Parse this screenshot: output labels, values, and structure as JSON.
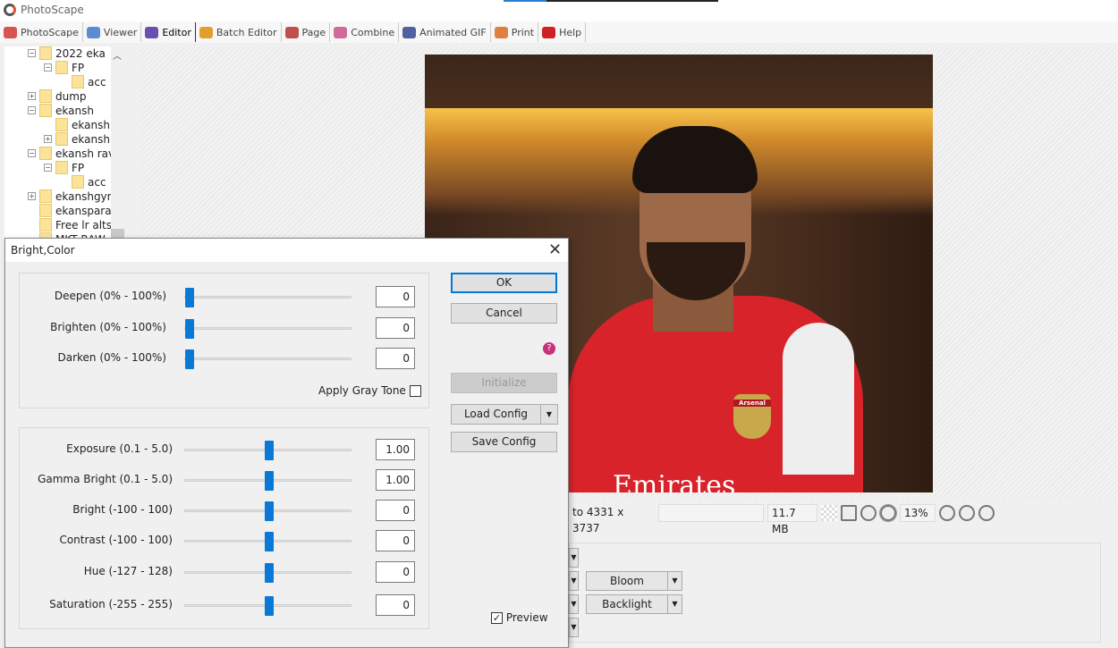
{
  "app": {
    "title": "PhotoScape"
  },
  "menu": [
    {
      "label": "PhotoScape",
      "icon": "photoscape-icon",
      "color": "#d9534f"
    },
    {
      "label": "Viewer",
      "icon": "viewer-icon",
      "color": "#5b8bd0"
    },
    {
      "label": "Editor",
      "icon": "editor-icon",
      "color": "#6a4fb0",
      "active": true
    },
    {
      "label": "Batch Editor",
      "icon": "batch-editor-icon",
      "color": "#e0a030"
    },
    {
      "label": "Page",
      "icon": "page-icon",
      "color": "#c0504d"
    },
    {
      "label": "Combine",
      "icon": "combine-icon",
      "color": "#d06a9a"
    },
    {
      "label": "Animated GIF",
      "icon": "animated-gif-icon",
      "color": "#5060a0"
    },
    {
      "label": "Print",
      "icon": "print-icon",
      "color": "#e08040"
    },
    {
      "label": "Help",
      "icon": "help-icon",
      "color": "#d02020"
    }
  ],
  "tree": [
    {
      "label": "2022 eka",
      "level": 1,
      "toggle": "-"
    },
    {
      "label": "FP",
      "level": 2,
      "toggle": "-"
    },
    {
      "label": "acc",
      "level": 3,
      "toggle": ""
    },
    {
      "label": "dump",
      "level": 1,
      "toggle": "+"
    },
    {
      "label": "ekansh",
      "level": 1,
      "toggle": "-"
    },
    {
      "label": "ekansh",
      "level": 2,
      "toggle": ""
    },
    {
      "label": "ekansh",
      "level": 2,
      "toggle": "+"
    },
    {
      "label": "ekansh rav",
      "level": 1,
      "toggle": "-"
    },
    {
      "label": "FP",
      "level": 2,
      "toggle": "-"
    },
    {
      "label": "acc",
      "level": 3,
      "toggle": ""
    },
    {
      "label": "ekanshgym",
      "level": 1,
      "toggle": "+"
    },
    {
      "label": "ekansparas",
      "level": 1,
      "toggle": ""
    },
    {
      "label": "Free lr alts",
      "level": 1,
      "toggle": ""
    },
    {
      "label": "MKT RAW",
      "level": 1,
      "toggle": ""
    }
  ],
  "photo": {
    "sponsor_text": "Emirates",
    "crest_text": "Arsenal"
  },
  "status": {
    "dimensions": "to 4331 x 3737",
    "info": "",
    "size": "11.7 MB",
    "zoom": "13%"
  },
  "lower_buttons": [
    "Bloom",
    "Backlight"
  ],
  "dialog": {
    "title": "Bright,Color",
    "close": "✕",
    "group1": [
      {
        "label": "Deepen (0% - 100%)",
        "value": "0",
        "position": 0
      },
      {
        "label": "Brighten (0% - 100%)",
        "value": "0",
        "position": 0
      },
      {
        "label": "Darken (0% - 100%)",
        "value": "0",
        "position": 0
      }
    ],
    "gray_tone_label": "Apply Gray Tone",
    "gray_tone_checked": false,
    "group2": [
      {
        "label": "Exposure (0.1 - 5.0)",
        "value": "1.00",
        "position": 0.5
      },
      {
        "label": "Gamma Bright (0.1 - 5.0)",
        "value": "1.00",
        "position": 0.5
      },
      {
        "label": "Bright (-100 - 100)",
        "value": "0",
        "position": 0.5
      },
      {
        "label": "Contrast (-100 - 100)",
        "value": "0",
        "position": 0.5
      },
      {
        "label": "Hue (-127 - 128)",
        "value": "0",
        "position": 0.5
      },
      {
        "label": "Saturation (-255 - 255)",
        "value": "0",
        "position": 0.5
      }
    ],
    "ok": "OK",
    "cancel": "Cancel",
    "initialize": "Initialize",
    "load_config": "Load Config",
    "save_config": "Save Config",
    "preview_label": "Preview",
    "preview_checked": true
  }
}
